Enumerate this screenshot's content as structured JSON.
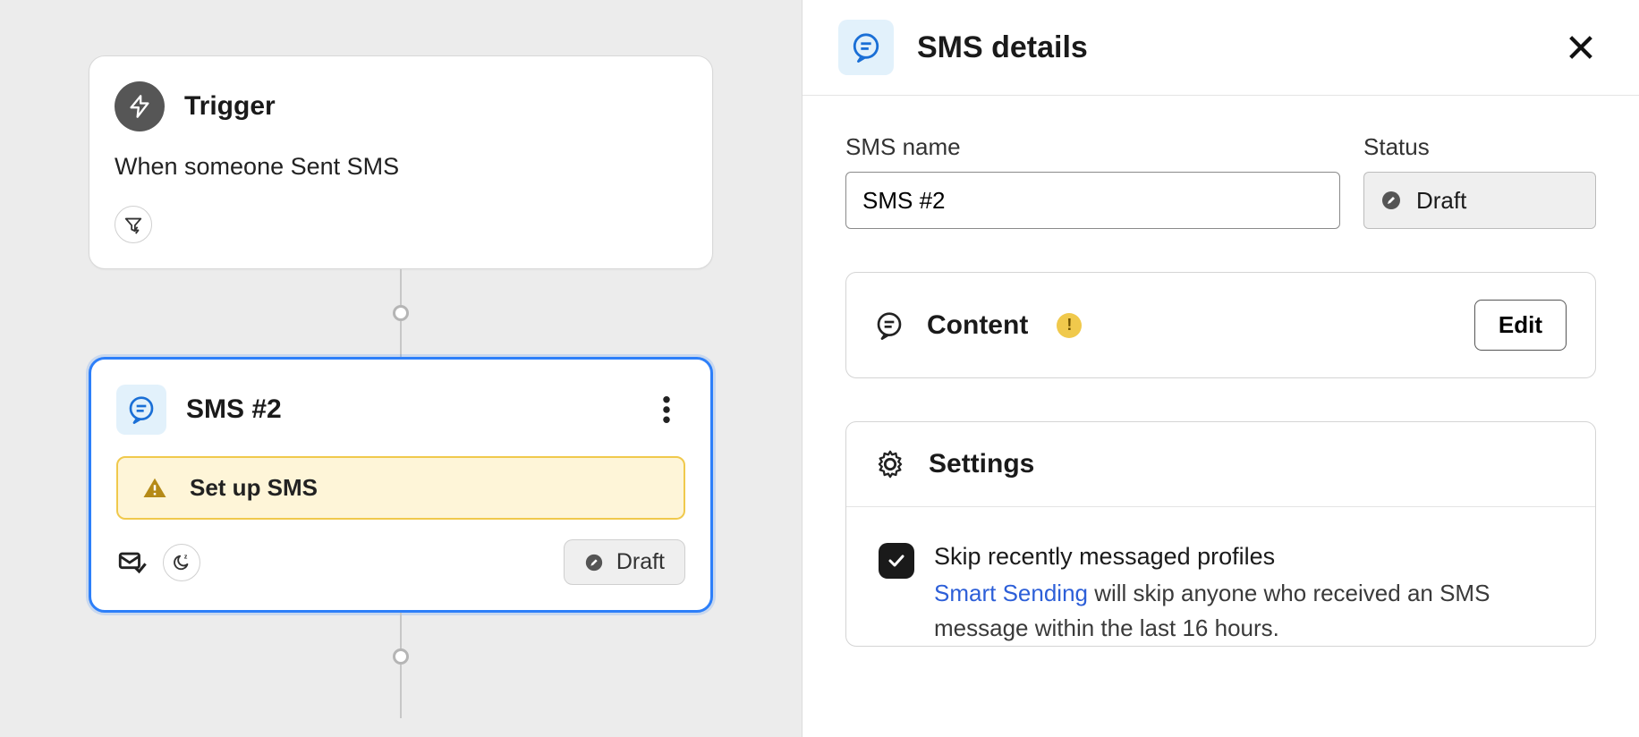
{
  "canvas": {
    "trigger": {
      "title": "Trigger",
      "description": "When someone Sent SMS"
    },
    "smsNode": {
      "title": "SMS #2",
      "warning": "Set up SMS",
      "status": "Draft"
    }
  },
  "panel": {
    "title": "SMS details",
    "nameField": {
      "label": "SMS name",
      "value": "SMS #2"
    },
    "statusField": {
      "label": "Status",
      "value": "Draft"
    },
    "content": {
      "title": "Content",
      "editLabel": "Edit"
    },
    "settings": {
      "title": "Settings",
      "skip": {
        "title": "Skip recently messaged profiles",
        "linkText": "Smart Sending",
        "descTail": " will skip anyone who received an SMS message within the last 16 hours."
      }
    }
  }
}
